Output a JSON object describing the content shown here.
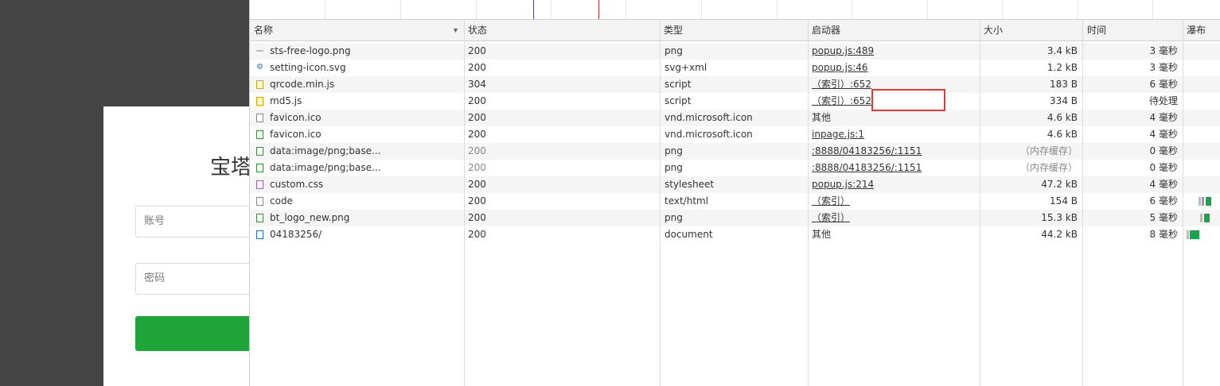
{
  "login": {
    "title": "宝塔",
    "username_placeholder": "账号",
    "password_placeholder": "密码",
    "button_color": "#20a53a"
  },
  "columns": {
    "name": "名称",
    "status": "状态",
    "type": "类型",
    "initiator": "启动器",
    "size": "大小",
    "time": "时间",
    "waterfall": "瀑布"
  },
  "rows": [
    {
      "icon": "line-icon",
      "name": "sts-free-logo.png",
      "status": "200",
      "type": "png",
      "initiator": "popup.js:489",
      "initiator_link": true,
      "size": "3.4 kB",
      "time": "3 毫秒"
    },
    {
      "icon": "gear-icon",
      "name": "setting-icon.svg",
      "status": "200",
      "type": "svg+xml",
      "initiator": "popup.js:46",
      "initiator_link": true,
      "size": "1.2 kB",
      "time": "3 毫秒"
    },
    {
      "icon": "script-icon",
      "name": "qrcode.min.js",
      "status": "304",
      "type": "script",
      "initiator": "（索引）:652",
      "initiator_link": true,
      "size": "183 B",
      "time": "6 毫秒"
    },
    {
      "icon": "script-icon",
      "name": "md5.js",
      "status": "200",
      "type": "script",
      "initiator": "（索引）:652",
      "initiator_link": true,
      "size": "334 B",
      "time": "待处理"
    },
    {
      "icon": "file-icon",
      "name": "favicon.ico",
      "status": "200",
      "type": "vnd.microsoft.icon",
      "initiator": "其他",
      "initiator_link": false,
      "size": "4.6 kB",
      "time": "4 毫秒"
    },
    {
      "icon": "image-icon",
      "name": "favicon.ico",
      "status": "200",
      "type": "vnd.microsoft.icon",
      "initiator": "inpage.js:1",
      "initiator_link": true,
      "size": "4.6 kB",
      "time": "4 毫秒"
    },
    {
      "icon": "image-icon",
      "name": "data:image/png;base...",
      "status": "200",
      "type": "png",
      "initiator": ":8888/04183256/:1151",
      "initiator_link": true,
      "size": "（内存缓存）",
      "time": "0 毫秒",
      "dim": true
    },
    {
      "icon": "image-icon",
      "name": "data:image/png;base...",
      "status": "200",
      "type": "png",
      "initiator": ":8888/04183256/:1151",
      "initiator_link": true,
      "size": "（内存缓存）",
      "time": "0 毫秒",
      "dim": true
    },
    {
      "icon": "stylesheet-icon",
      "name": "custom.css",
      "status": "200",
      "type": "stylesheet",
      "initiator": "popup.js:214",
      "initiator_link": true,
      "size": "47.2 kB",
      "time": "4 毫秒"
    },
    {
      "icon": "file-icon",
      "name": "code",
      "status": "200",
      "type": "text/html",
      "initiator": "（索引）",
      "initiator_link": true,
      "size": "154 B",
      "time": "6 毫秒"
    },
    {
      "icon": "image-icon",
      "name": "bt_logo_new.png",
      "status": "200",
      "type": "png",
      "initiator": "（索引）",
      "initiator_link": true,
      "size": "15.3 kB",
      "time": "5 毫秒"
    },
    {
      "icon": "document-icon",
      "name": "04183256/",
      "status": "200",
      "type": "document",
      "initiator": "其他",
      "initiator_link": false,
      "size": "44.2 kB",
      "time": "8 毫秒"
    }
  ],
  "highlight_color": "#e53935",
  "waterfall_color": "#1aa34a"
}
